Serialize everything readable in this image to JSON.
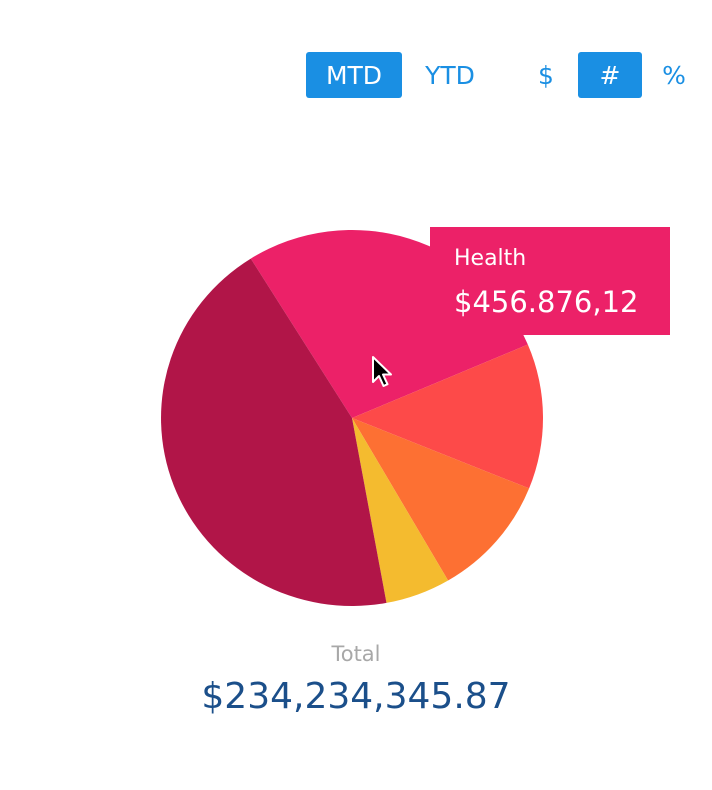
{
  "controls": {
    "period": [
      {
        "label": "MTD",
        "active": true
      },
      {
        "label": "YTD",
        "active": false
      }
    ],
    "units": [
      {
        "label": "$",
        "active": false
      },
      {
        "label": "#",
        "active": true
      },
      {
        "label": "%",
        "active": false
      }
    ],
    "accent_color": "#1a8fe3"
  },
  "chart_data": {
    "type": "pie",
    "slices": [
      {
        "value": 27.5,
        "color": "#ec2168"
      },
      {
        "value": 12.5,
        "color": "#fd4a49"
      },
      {
        "value": 10.5,
        "color": "#fd7033"
      },
      {
        "value": 5.5,
        "color": "#f4bb2f"
      },
      {
        "value": 44.0,
        "color": "#b11548"
      }
    ],
    "tooltip": {
      "label": "Health",
      "value": "$456.876,12",
      "color": "#ec2168"
    }
  },
  "total": {
    "label": "Total",
    "value": "$234,234,345.87"
  }
}
